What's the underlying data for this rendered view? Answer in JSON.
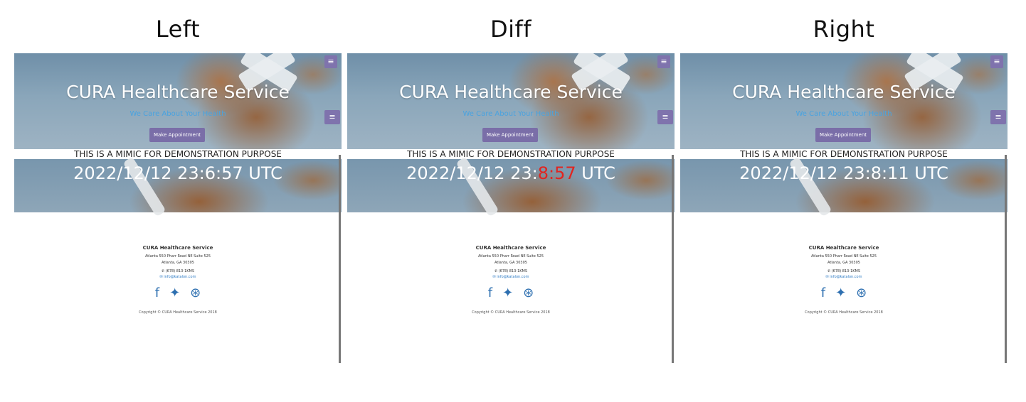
{
  "columns": [
    {
      "title": "Left",
      "clock": "2022/12/12 23:6:57 UTC",
      "clock_pre": "2022/12/12 23:",
      "clock_diff": "6:57",
      "clock_post": " UTC"
    },
    {
      "title": "Diff",
      "clock": "2022/12/12 23:8:11 UTC",
      "clock_pre": "2022/12/12 23:",
      "clock_diff": "8:57",
      "clock_post": " UTC"
    },
    {
      "title": "Right",
      "clock": "2022/12/12 23:8:11 UTC",
      "clock_pre": "2022/12/12 23:",
      "clock_diff": "8:11",
      "clock_post": " UTC"
    }
  ],
  "hero": {
    "title": "CURA Healthcare Service",
    "subtitle": "We Care About Your Health",
    "button": "Make Appointment",
    "menu_icon": "menu-icon"
  },
  "mimic_text": "THIS IS A MIMIC FOR DEMONSTRATION PURPOSE",
  "footer": {
    "name": "CURA Healthcare Service",
    "address1": "Atlanta 550 Pharr Road NE Suite 525",
    "address2": "Atlanta, GA 30305",
    "phone": "(678) 813-1KMS",
    "email": "info@katalon.com",
    "copyright": "Copyright © CURA Healthcare Service 2018",
    "social": [
      "facebook-icon",
      "twitter-icon",
      "dribbble-icon"
    ]
  },
  "colors": {
    "accent": "#7a6ea8",
    "link": "#2e7bc4",
    "subtitle": "#4aa3df",
    "diff": "#e2241f"
  }
}
